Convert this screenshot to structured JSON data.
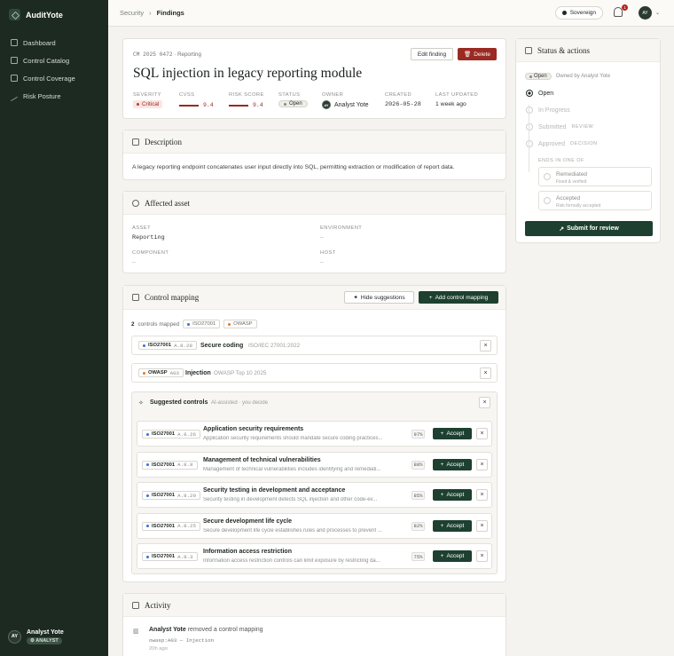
{
  "app": {
    "name": "AuditYote"
  },
  "sidebar": {
    "items": [
      {
        "label": "Dashboard",
        "icon": "grid-icon"
      },
      {
        "label": "Control Catalog",
        "icon": "list-icon"
      },
      {
        "label": "Control Coverage",
        "icon": "map-icon"
      },
      {
        "label": "Risk Posture",
        "icon": "trend-icon"
      }
    ],
    "user": {
      "initials": "AY",
      "name": "Analyst Yote",
      "role": "ANALYST"
    }
  },
  "topbar": {
    "crumb1": "Security",
    "crumb2": "Findings",
    "env": "Sovereign",
    "notif_count": "1",
    "avatar": "AY"
  },
  "finding": {
    "id": "CM 2025 0472",
    "category": "Reporting",
    "title": "SQL injection in legacy reporting module",
    "edit_label": "Edit finding",
    "delete_label": "Delete",
    "fields": {
      "severity_label": "SEVERITY",
      "severity": "Critical",
      "cvss_label": "CVSS",
      "cvss": "9.4",
      "risk_label": "RISK SCORE",
      "risk": "9.4",
      "status_label": "STATUS",
      "status": "Open",
      "owner_label": "OWNER",
      "owner": "Analyst Yote",
      "owner_initials": "AY",
      "created_label": "CREATED",
      "created": "2026-05-28",
      "updated_label": "LAST UPDATED",
      "updated": "1 week ago"
    }
  },
  "description": {
    "title": "Description",
    "text": "A legacy reporting endpoint concatenates user input directly into SQL, permitting extraction or modification of report data."
  },
  "asset": {
    "title": "Affected asset",
    "asset_label": "ASSET",
    "asset": "Reporting",
    "env_label": "ENVIRONMENT",
    "env": "–",
    "component_label": "COMPONENT",
    "component": "–",
    "host_label": "HOST",
    "host": "–"
  },
  "mapping": {
    "title": "Control mapping",
    "hide_label": "Hide suggestions",
    "add_label": "Add control mapping",
    "count": "2",
    "count_text": "controls mapped",
    "filter1": "ISO27001",
    "filter2": "OWASP",
    "mapped": [
      {
        "fw": "ISO27001",
        "code": "A.8.28",
        "name": "Secure coding",
        "source": "ISO/IEC 27001:2022"
      },
      {
        "fw": "OWASP",
        "code": "A03",
        "name": "Injection",
        "source": "OWASP Top 10 2025"
      }
    ],
    "suggest_title": "Suggested controls",
    "suggest_sub": "AI-assisted · you decide",
    "accept_label": "Accept",
    "suggestions": [
      {
        "fw": "ISO27001",
        "code": "A.8.26",
        "title": "Application security requirements",
        "desc": "Application security requirements should mandate secure coding practices...",
        "score": "97%"
      },
      {
        "fw": "ISO27001",
        "code": "A.8.8",
        "title": "Management of technical vulnerabilities",
        "desc": "Management of technical vulnerabilities includes identifying and remediati...",
        "score": "88%"
      },
      {
        "fw": "ISO27001",
        "code": "A.8.29",
        "title": "Security testing in development and acceptance",
        "desc": "Security testing in development detects SQL injection and other code-ev...",
        "score": "85%"
      },
      {
        "fw": "ISO27001",
        "code": "A.8.25",
        "title": "Secure development life cycle",
        "desc": "Secure development life cycle establishes rules and processes to prevent ...",
        "score": "82%"
      },
      {
        "fw": "ISO27001",
        "code": "A.8.3",
        "title": "Information access restriction",
        "desc": "Information access restriction controls can limit exposure by restricting da...",
        "score": "75%"
      }
    ]
  },
  "activity": {
    "title": "Activity",
    "actor": "Analyst Yote",
    "action": "removed a control mapping",
    "detail": "owasp:A03 — Injection",
    "time": "20h ago"
  },
  "status_panel": {
    "title": "Status & actions",
    "badge": "Open",
    "owned_by": "Owned by Analyst Yote",
    "steps": [
      {
        "label": "Open",
        "sub": ""
      },
      {
        "label": "In Progress",
        "sub": ""
      },
      {
        "label": "Submitted",
        "sub": "REVIEW"
      },
      {
        "label": "Approved",
        "sub": "DECISION"
      }
    ],
    "ends_label": "ENDS IN ONE OF",
    "end1": "Remediated",
    "end1_sub": "Fixed & verified",
    "end2": "Accepted",
    "end2_sub": "Risk formally accepted",
    "submit_label": "Submit for review"
  }
}
